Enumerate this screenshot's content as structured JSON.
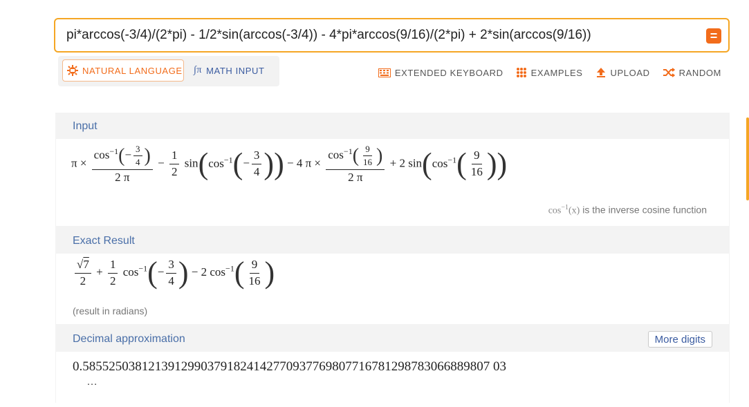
{
  "search": {
    "query": "pi*arccos(-3/4)/(2*pi) - 1/2*sin(arccos(-3/4)) - 4*pi*arccos(9/16)/(2*pi) + 2*sin(arccos(9/16))"
  },
  "modes": {
    "natural_language": "NATURAL LANGUAGE",
    "math_input": "MATH INPUT"
  },
  "toolbar": {
    "extended_keyboard": "EXTENDED KEYBOARD",
    "examples": "EXAMPLES",
    "upload": "UPLOAD",
    "random": "RANDOM"
  },
  "pods": {
    "input": {
      "title": "Input",
      "note_func": "cos",
      "note_sup": "−1",
      "note_arg": "(x)",
      "note_text": " is the inverse cosine function"
    },
    "exact": {
      "title": "Exact Result",
      "caption": "(result in radians)"
    },
    "decimal": {
      "title": "Decimal approximation",
      "more_button": "More digits",
      "value": "0.58552503812139129903791824142770937769807716781298783066889807 03",
      "ellipsis": "…"
    }
  },
  "colors": {
    "accent_orange": "#f26c1b",
    "search_border": "#f5a623",
    "link_blue": "#3a5ba0"
  }
}
